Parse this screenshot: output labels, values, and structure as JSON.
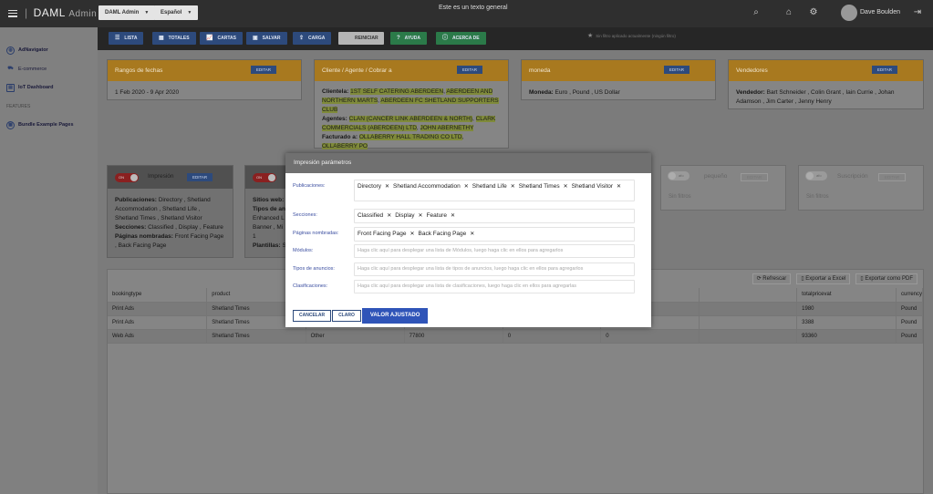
{
  "header": {
    "brand_main": "DAML",
    "brand_sub": "Admin",
    "app_dropdown": "DAML Admin",
    "lang_dropdown": "Español",
    "general_text": "Este es un texto general",
    "user_name": "Dave Boulden"
  },
  "sidebar": {
    "items": [
      {
        "label": "AdNavigator",
        "icon": "globe-icon"
      },
      {
        "label": "E-commerce",
        "icon": "cart-icon"
      },
      {
        "label": "IoT Dashboard",
        "icon": "dashboard-icon"
      }
    ],
    "features_label": "FEATURES",
    "bundle_label": "Bundle Example Pages"
  },
  "toolbar": {
    "buttons": [
      "LISTA",
      "TOTALES",
      "CARTAS",
      "SALVAR",
      "CARGA",
      "REINICIAR",
      "AYUDA",
      "ACERCA DE"
    ],
    "note": "Sin filtro aplicado actualmente (ningún filtro)"
  },
  "cards": {
    "fechas": {
      "title": "Rangos de fechas",
      "edit": "EDITAR",
      "value": "1 Feb 2020 - 9 Apr 2020"
    },
    "cliente": {
      "title": "Cliente / Agente / Cobrar a",
      "edit": "EDITAR",
      "clientela_label": "Clientela:",
      "clientela": [
        "1ST SELF CATERING ABERDEEN",
        "ABERDEEN AND NORTHERN MARTS",
        "ABERDEEN FC SHETLAND SUPPORTERS CLUB"
      ],
      "agentes_label": "Agentes:",
      "agentes": [
        "CLAN (CANCER LINK ABERDEEN & NORTH)",
        "CLARK COMMERCIALS (ABERDEEN) LTD",
        "JOHN ABERNETHY"
      ],
      "facturado_label": "Facturado a:",
      "facturado": [
        "OLLABERRY HALL TRADING CO LTD",
        "OLLABERRY PO"
      ]
    },
    "moneda": {
      "title": "moneda",
      "edit": "EDITAR",
      "label": "Moneda:",
      "values": [
        "Euro",
        "Pound",
        "US Dollar"
      ]
    },
    "vendedores": {
      "title": "Vendedores",
      "edit": "EDITAR",
      "label": "Vendedor:",
      "values": [
        "Bart Schneider",
        "Colin Grant",
        "Iain Currie",
        "Johan Adamson",
        "Jim Carter",
        "Jenny Henry"
      ]
    },
    "impresion": {
      "title": "Impresión",
      "edit": "EDITAR",
      "toggle": "ON",
      "pub_label": "Publicaciones:",
      "pubs": [
        "Directory",
        "Shetland Accommodation",
        "Shetland Life",
        "Shetland Times",
        "Shetland Visitor"
      ],
      "sec_label": "Secciones:",
      "secs": [
        "Classified",
        "Display",
        "Feature"
      ],
      "pag_label": "Páginas nombradas:",
      "pags": [
        "Front Facing Page",
        "Back Facing Page"
      ]
    },
    "web": {
      "toggle": "ON",
      "line1_label": "Sitios web:",
      "line2_label": "Tipos de an",
      "line3": "Enhanced L",
      "line4": "Banner , Mi",
      "line5": "1",
      "line6_label": "Plantillas:",
      "line6": "S"
    },
    "pequeno": {
      "toggle": "afo",
      "title": "pequeño",
      "edit": "EDITAR",
      "nofilter": "Sin filtros"
    },
    "suscripcion": {
      "toggle": "afo",
      "title": "Suscripción",
      "edit": "EDITAR",
      "nofilter": "Sin filtros"
    }
  },
  "table": {
    "actions": [
      "Refrescar",
      "Exportar a Excel",
      "Exportar como PDF"
    ],
    "columns": [
      "bookingtype",
      "product",
      "",
      "",
      "",
      "",
      "",
      "totalpricevat",
      "currency"
    ],
    "rows": [
      [
        "Print Ads",
        "Shetland Times",
        "",
        "",
        "",
        "",
        "",
        "1980",
        "Pound"
      ],
      [
        "Print Ads",
        "Shetland Times",
        "",
        "",
        "",
        "",
        "",
        "3388",
        "Pound"
      ],
      [
        "Web Ads",
        "Shetland Times",
        "Other",
        "77800",
        "0",
        "0",
        "",
        "93360",
        "Pound"
      ]
    ]
  },
  "modal": {
    "title": "Impresión parámetros",
    "fields": [
      {
        "label": "Publicaciones:",
        "chips": [
          "Directory",
          "Shetland Accommodation",
          "Shetland Life",
          "Shetland Times",
          "Shetland Visitor"
        ]
      },
      {
        "label": "Secciones:",
        "chips": [
          "Classified",
          "Display",
          "Feature"
        ]
      },
      {
        "label": "Páginas nombradas:",
        "chips": [
          "Front Facing Page",
          "Back Facing Page"
        ]
      },
      {
        "label": "Módulos:",
        "placeholder": "Haga clic aquí para desplegar una lista de Módulos, luego haga clic en ellos para agregarlos"
      },
      {
        "label": "Tipos de anuncios:",
        "placeholder": "Haga clic aquí para desplegar una lista de tipos de anuncios, luego haga clic en ellos para agregarlos"
      },
      {
        "label": "Clasificaciones:",
        "placeholder": "Haga clic aquí para desplegar una lista de clasificaciones, luego haga clic en ellos para agregarlas"
      }
    ],
    "cancel": "CANCELAR",
    "clear": "CLARO",
    "apply": "VALOR AJUSTADO"
  }
}
